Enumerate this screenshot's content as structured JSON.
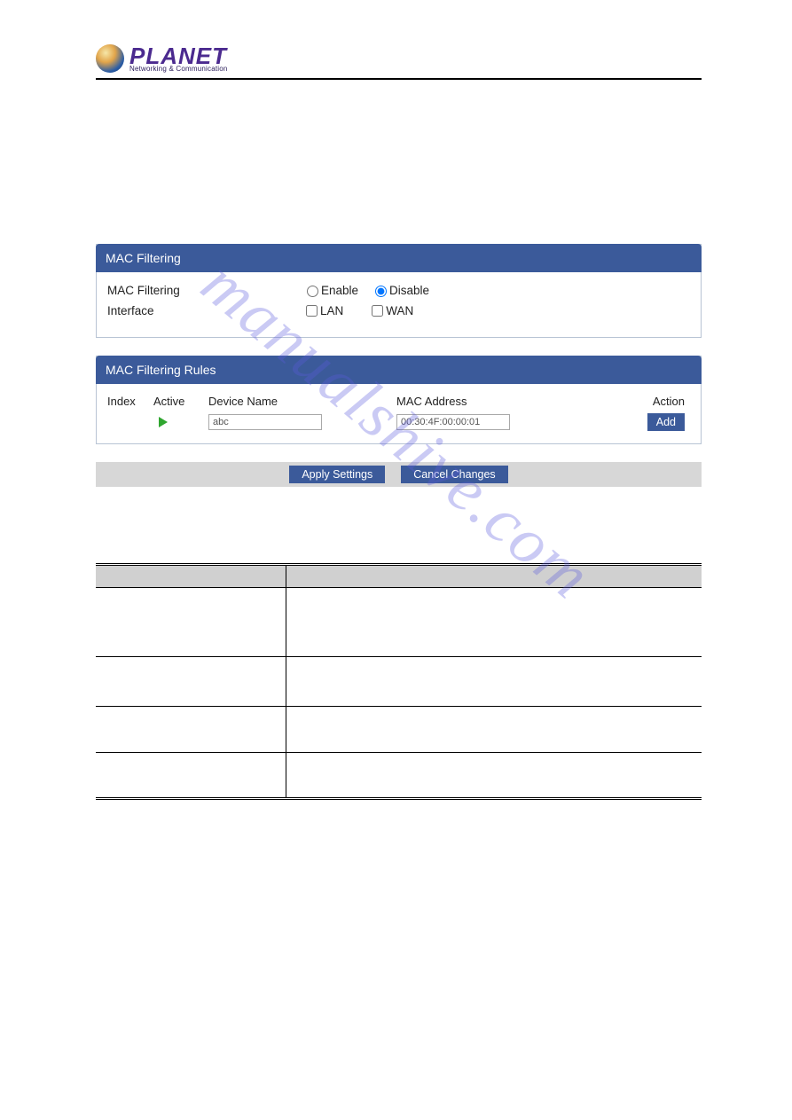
{
  "logo": {
    "brand": "PLANET",
    "tagline": "Networking & Communication"
  },
  "watermark": "manualshive.com",
  "panel_filter": {
    "title": "MAC Filtering",
    "rows": {
      "mac_filtering_label": "MAC Filtering",
      "interface_label": "Interface"
    },
    "options": {
      "enable": "Enable",
      "disable": "Disable",
      "lan": "LAN",
      "wan": "WAN"
    }
  },
  "panel_rules": {
    "title": "MAC Filtering Rules",
    "columns": {
      "index": "Index",
      "active": "Active",
      "device": "Device Name",
      "mac": "MAC Address",
      "action": "Action"
    },
    "row": {
      "device_value": "abc",
      "mac_value": "00:30:4F:00:00:01",
      "add_label": "Add"
    }
  },
  "footer": {
    "apply": "Apply Settings",
    "cancel": "Cancel Changes"
  }
}
